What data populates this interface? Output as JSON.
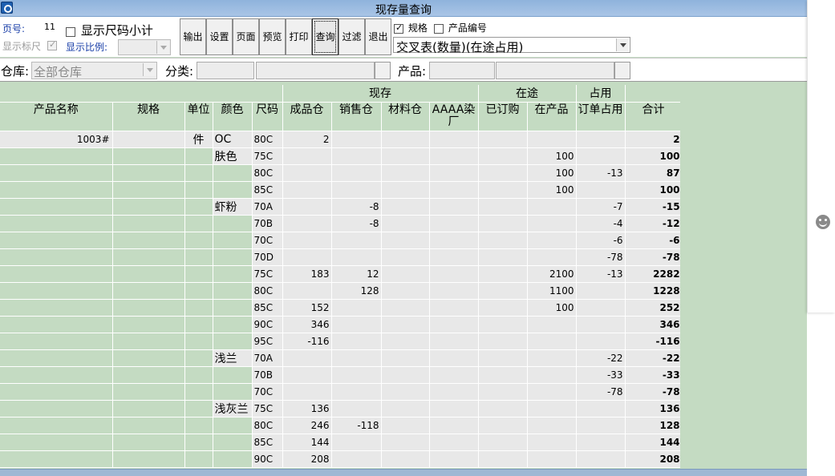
{
  "window": {
    "title": "现存量查询"
  },
  "toolbar": {
    "page_label": "页号:",
    "page_value": "11",
    "show_size_subtotal_label": "显示尺码小计",
    "show_ruler_label": "显示标尺",
    "show_scale_label": "显示比例:",
    "buttons": [
      {
        "label": "输出"
      },
      {
        "label": "设置"
      },
      {
        "label": "页面"
      },
      {
        "label": "预览"
      },
      {
        "label": "打印"
      },
      {
        "label": "查询"
      },
      {
        "label": "过滤"
      },
      {
        "label": "退出"
      }
    ],
    "spec_label": "规格",
    "product_code_label": "产品编号",
    "view_mode_value": "交叉表(数量)(在途占用)"
  },
  "filters": {
    "warehouse_label": "仓库:",
    "warehouse_value": "全部仓库",
    "category_label": "分类:",
    "product_label": "产品:"
  },
  "grid": {
    "group_headers": {
      "stock": "现存",
      "in_transit": "在途",
      "occupied": "占用"
    },
    "columns": {
      "name": "产品名称",
      "spec": "规格",
      "unit": "单位",
      "color": "颜色",
      "size": "尺码",
      "finished_wh": "成品仓",
      "sales_wh": "销售仓",
      "material_wh": "材料仓",
      "aaaa_dye": "AAAA染厂",
      "ordered": "已订购",
      "in_production": "在产品",
      "order_occupied": "订单占用",
      "total": "合计"
    },
    "rows": [
      {
        "name": "1003#",
        "unit": "件",
        "color": "OC",
        "size": "80C",
        "finished": "2",
        "sales": "",
        "material": "",
        "dye": "",
        "ordered": "",
        "in_prod": "",
        "occupied": "",
        "total": "2"
      },
      {
        "color": "肤色",
        "size": "75C",
        "finished": "",
        "sales": "",
        "material": "",
        "dye": "",
        "ordered": "",
        "in_prod": "100",
        "occupied": "",
        "total": "100"
      },
      {
        "size": "80C",
        "finished": "",
        "sales": "",
        "material": "",
        "dye": "",
        "ordered": "",
        "in_prod": "100",
        "occupied": "-13",
        "total": "87"
      },
      {
        "size": "85C",
        "finished": "",
        "sales": "",
        "material": "",
        "dye": "",
        "ordered": "",
        "in_prod": "100",
        "occupied": "",
        "total": "100"
      },
      {
        "color": "虾粉",
        "size": "70A",
        "finished": "",
        "sales": "-8",
        "material": "",
        "dye": "",
        "ordered": "",
        "in_prod": "",
        "occupied": "-7",
        "total": "-15"
      },
      {
        "size": "70B",
        "finished": "",
        "sales": "-8",
        "material": "",
        "dye": "",
        "ordered": "",
        "in_prod": "",
        "occupied": "-4",
        "total": "-12"
      },
      {
        "size": "70C",
        "finished": "",
        "sales": "",
        "material": "",
        "dye": "",
        "ordered": "",
        "in_prod": "",
        "occupied": "-6",
        "total": "-6"
      },
      {
        "size": "70D",
        "finished": "",
        "sales": "",
        "material": "",
        "dye": "",
        "ordered": "",
        "in_prod": "",
        "occupied": "-78",
        "total": "-78"
      },
      {
        "size": "75C",
        "finished": "183",
        "sales": "12",
        "material": "",
        "dye": "",
        "ordered": "",
        "in_prod": "2100",
        "occupied": "-13",
        "total": "2282"
      },
      {
        "size": "80C",
        "finished": "",
        "sales": "128",
        "material": "",
        "dye": "",
        "ordered": "",
        "in_prod": "1100",
        "occupied": "",
        "total": "1228"
      },
      {
        "size": "85C",
        "finished": "152",
        "sales": "",
        "material": "",
        "dye": "",
        "ordered": "",
        "in_prod": "100",
        "occupied": "",
        "total": "252"
      },
      {
        "size": "90C",
        "finished": "346",
        "sales": "",
        "material": "",
        "dye": "",
        "ordered": "",
        "in_prod": "",
        "occupied": "",
        "total": "346"
      },
      {
        "size": "95C",
        "finished": "-116",
        "sales": "",
        "material": "",
        "dye": "",
        "ordered": "",
        "in_prod": "",
        "occupied": "",
        "total": "-116"
      },
      {
        "color": "浅兰",
        "size": "70A",
        "finished": "",
        "sales": "",
        "material": "",
        "dye": "",
        "ordered": "",
        "in_prod": "",
        "occupied": "-22",
        "total": "-22"
      },
      {
        "size": "70B",
        "finished": "",
        "sales": "",
        "material": "",
        "dye": "",
        "ordered": "",
        "in_prod": "",
        "occupied": "-33",
        "total": "-33"
      },
      {
        "size": "70C",
        "finished": "",
        "sales": "",
        "material": "",
        "dye": "",
        "ordered": "",
        "in_prod": "",
        "occupied": "-78",
        "total": "-78"
      },
      {
        "color": "浅灰兰",
        "size": "75C",
        "finished": "136",
        "sales": "",
        "material": "",
        "dye": "",
        "ordered": "",
        "in_prod": "",
        "occupied": "",
        "total": "136"
      },
      {
        "size": "80C",
        "finished": "246",
        "sales": "-118",
        "material": "",
        "dye": "",
        "ordered": "",
        "in_prod": "",
        "occupied": "",
        "total": "128"
      },
      {
        "size": "85C",
        "finished": "144",
        "sales": "",
        "material": "",
        "dye": "",
        "ordered": "",
        "in_prod": "",
        "occupied": "",
        "total": "144"
      },
      {
        "size": "90C",
        "finished": "208",
        "sales": "",
        "material": "",
        "dye": "",
        "ordered": "",
        "in_prod": "",
        "occupied": "",
        "total": "208"
      }
    ]
  }
}
